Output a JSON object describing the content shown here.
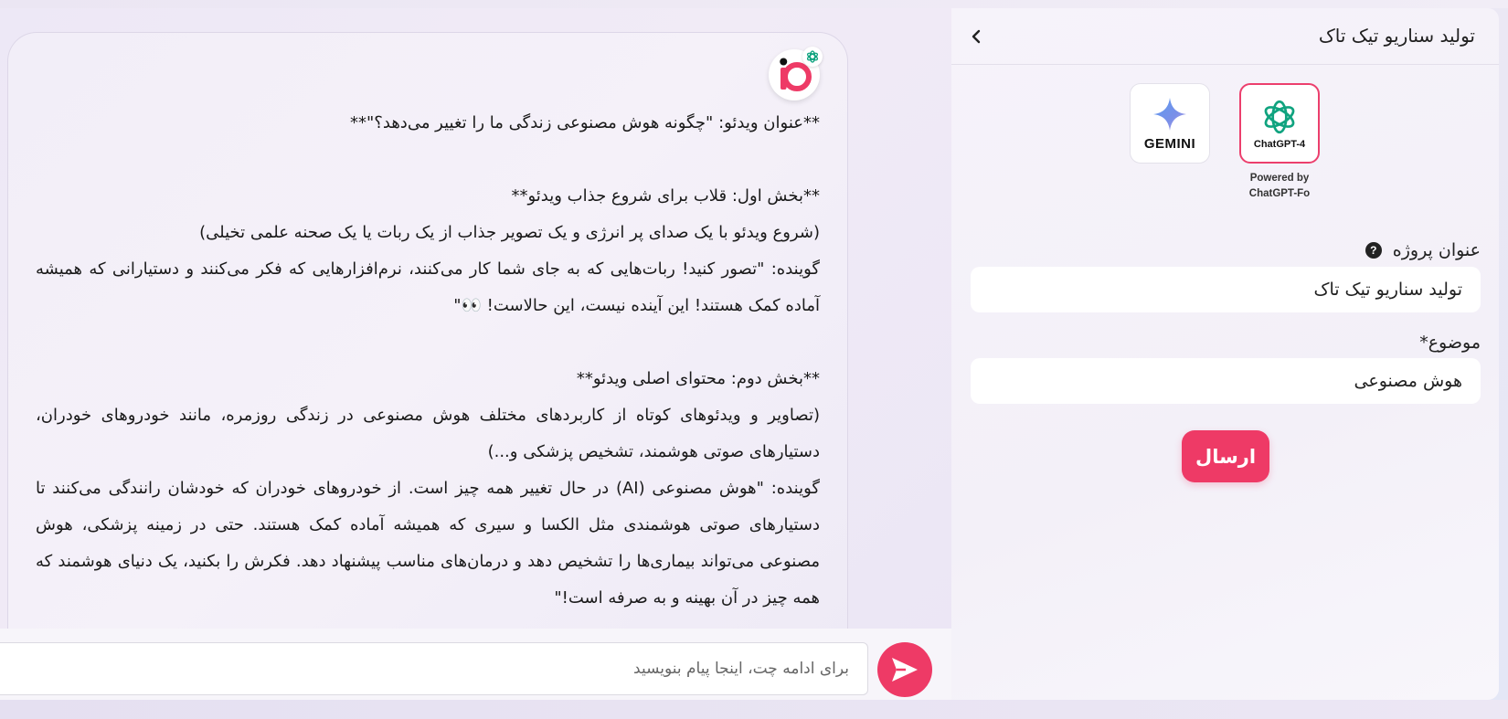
{
  "sidebar": {
    "title": "تولید سناریو تیک تاک",
    "models": [
      {
        "name": "ChatGPT-4",
        "icon": "openai-logo-icon",
        "selected": true
      },
      {
        "name": "GEMINI",
        "icon": "gemini-star-icon",
        "selected": false
      }
    ],
    "powered_by": "Powered by ChatGPT-Fo",
    "project_title_label": "عنوان پروژه",
    "project_title_value": "تولید سناریو تیک تاک",
    "topic_label": "موضوع*",
    "topic_value": "هوش مصنوعی",
    "submit_label": "ارسال"
  },
  "chat": {
    "message_lines": [
      "**عنوان ویدئو: \"چگونه هوش مصنوعی زندگی ما را تغییر می‌دهد؟\"**",
      "",
      "**بخش اول: قلاب برای شروع جذاب ویدئو**",
      "(شروع ویدئو با یک صدای پر انرژی و یک تصویر جذاب از یک ربات یا یک صحنه علمی تخیلی)",
      "گوینده: \"تصور کنید! ربات‌هایی که به جای شما کار می‌کنند، نرم‌افزارهایی که فکر می‌کنند و دستیارانی که همیشه آماده کمک هستند! این آینده نیست، این حالاست! 👀\"",
      "",
      "**بخش دوم: محتوای اصلی ویدئو**",
      "(تصاویر و ویدئوهای کوتاه از کاربردهای مختلف هوش مصنوعی در زندگی روزمره، مانند خودروهای خودران، دستیارهای صوتی هوشمند، تشخیص پزشکی و...)",
      "گوینده: \"هوش مصنوعی (AI) در حال تغییر همه چیز است. از خودروهای خودران که خودشان رانندگی می‌کنند تا دستیارهای صوتی هوشمندی مثل الکسا و سیری که همیشه آماده کمک هستند. حتی در زمینه پزشکی، هوش مصنوعی می‌تواند بیماری‌ها را تشخیص دهد و درمان‌های مناسب پیشنهاد دهد. فکرش را بکنید، یک دنیای هوشمند که همه چیز در آن بهینه و به صرفه است!\""
    ],
    "input_placeholder": "برای ادامه چت، اینجا پیام بنویسید",
    "input_value": ""
  },
  "colors": {
    "accent": "#ee3a66",
    "openai_green": "#10a37f",
    "text": "#1a1a1a"
  }
}
